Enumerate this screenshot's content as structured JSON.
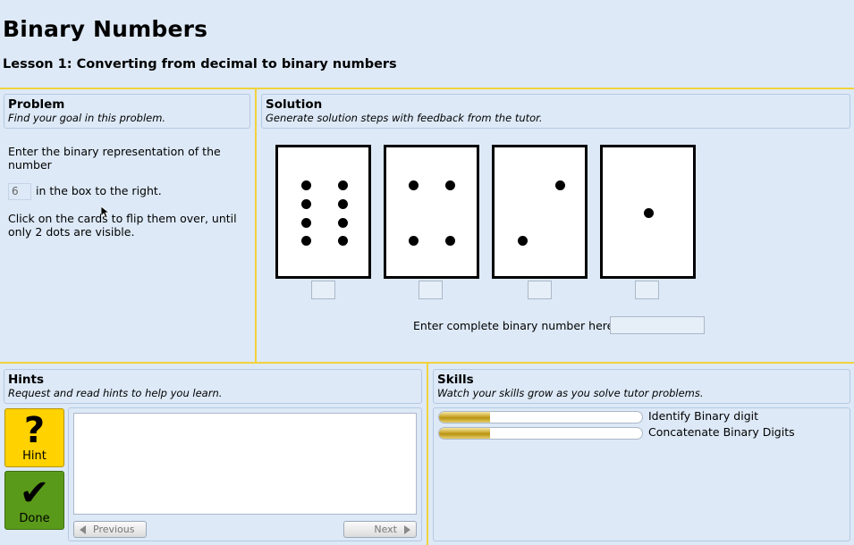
{
  "page": {
    "title": "Binary Numbers",
    "lesson": "Lesson 1: Converting from decimal to binary numbers"
  },
  "problem": {
    "heading": "Problem",
    "subheading": "Find your goal in this problem.",
    "line1": "Enter the binary representation of the number",
    "number": "6",
    "line2": "in the box to the right.",
    "line3": "Click on the cards to flip them over, until only 2 dots are visible."
  },
  "solution": {
    "heading": "Solution",
    "subheading": "Generate solution steps with feedback from the tutor.",
    "cards": [
      {
        "dots": 8
      },
      {
        "dots": 4
      },
      {
        "dots": 2
      },
      {
        "dots": 1
      }
    ],
    "binary_label": "Enter complete binary number here:",
    "binary_value": ""
  },
  "hints": {
    "heading": "Hints",
    "subheading": "Request and read hints to help you learn.",
    "hint_button_label": "Hint",
    "done_button_label": "Done",
    "hint_glyph": "?",
    "done_glyph": "✔",
    "previous_label": "Previous",
    "next_label": "Next",
    "text": ""
  },
  "skills": {
    "heading": "Skills",
    "subheading": "Watch your skills grow as you solve tutor problems.",
    "items": [
      {
        "name": "Identify Binary digit",
        "progress": 0.25
      },
      {
        "name": "Concatenate Binary Digits",
        "progress": 0.25
      }
    ]
  },
  "colors": {
    "background": "#dde9f7",
    "divider": "#f1d23c",
    "hint_button": "#ffd200",
    "done_button": "#5a9a1a"
  }
}
